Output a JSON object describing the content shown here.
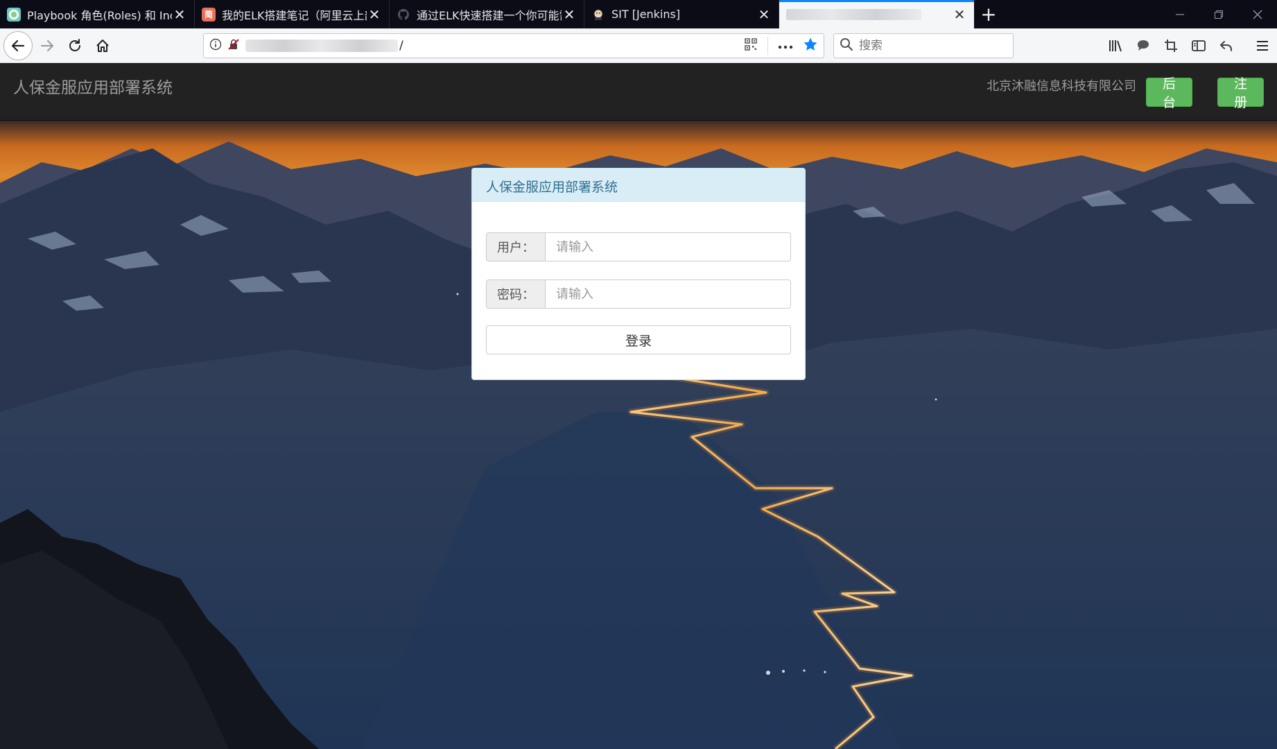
{
  "browser": {
    "tabs": [
      {
        "title": "Playbook 角色(Roles) 和 Inclu",
        "favicon": "playbook-favicon"
      },
      {
        "title": "我的ELK搭建笔记（阿里云上部",
        "favicon": "jianshu-favicon",
        "favicon_text": "简"
      },
      {
        "title": "通过ELK快速搭建一个你可能需",
        "favicon": "github-favicon"
      },
      {
        "title": "SIT [Jenkins]",
        "favicon": "jenkins-favicon"
      },
      {
        "title": "",
        "favicon": "none",
        "active": true
      }
    ],
    "new_tab_label": "+",
    "url_suffix": "/",
    "search_placeholder": "搜索"
  },
  "header": {
    "brand": "人保金服应用部署系统",
    "company": "北京沐融信息科技有限公司",
    "admin_button": "后台",
    "register_button": "注册",
    "background_color": "#222222",
    "button_color": "#5cb85c"
  },
  "login": {
    "panel_title": "人保金服应用部署系统",
    "user_label": "用户：",
    "user_placeholder": "请输入",
    "password_label": "密码：",
    "password_placeholder": "请输入",
    "submit_label": "登录",
    "heading_color": "#d9edf7",
    "heading_text_color": "#31708f"
  }
}
